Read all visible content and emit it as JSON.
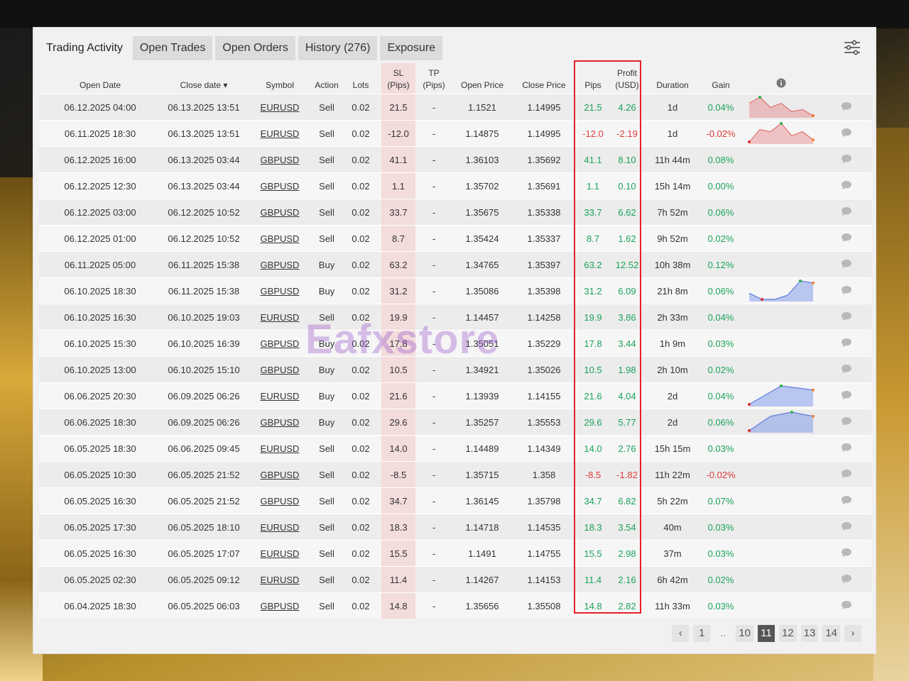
{
  "tabs": [
    {
      "label": "Trading Activity"
    },
    {
      "label": "Open Trades"
    },
    {
      "label": "Open Orders"
    },
    {
      "label": "History (276)"
    },
    {
      "label": "Exposure"
    }
  ],
  "columns": {
    "open_date": "Open Date",
    "close_date": "Close date ▾",
    "symbol": "Symbol",
    "action": "Action",
    "lots": "Lots",
    "sl_line1": "SL",
    "sl_line2": "(Pips)",
    "tp_line1": "TP",
    "tp_line2": "(Pips)",
    "open_price": "Open Price",
    "close_price": "Close Price",
    "pips": "Pips",
    "profit_line1": "Profit",
    "profit_line2": "(USD)",
    "duration": "Duration",
    "gain": "Gain"
  },
  "rows": [
    {
      "open": "06.12.2025 04:00",
      "close": "06.13.2025 13:51",
      "symbol": "EURUSD",
      "action": "Sell",
      "lots": "0.02",
      "sl": "21.5",
      "tp": "-",
      "open_price": "1.1521",
      "close_price": "1.14995",
      "pips": "21.5",
      "profit": "4.26",
      "duration": "1d",
      "gain": "0.04%",
      "neg": false,
      "spark": [
        6,
        9,
        4,
        6,
        2,
        3,
        0
      ]
    },
    {
      "open": "06.11.2025 18:30",
      "close": "06.13.2025 13:51",
      "symbol": "EURUSD",
      "action": "Sell",
      "lots": "0.02",
      "sl": "-12.0",
      "tp": "-",
      "open_price": "1.14875",
      "close_price": "1.14995",
      "pips": "-12.0",
      "profit": "-2.19",
      "duration": "1d",
      "gain": "-0.02%",
      "neg": true,
      "spark": [
        0,
        6,
        5,
        9,
        3,
        5,
        1
      ]
    },
    {
      "open": "06.12.2025 16:00",
      "close": "06.13.2025 03:44",
      "symbol": "GBPUSD",
      "action": "Sell",
      "lots": "0.02",
      "sl": "41.1",
      "tp": "-",
      "open_price": "1.36103",
      "close_price": "1.35692",
      "pips": "41.1",
      "profit": "8.10",
      "duration": "11h 44m",
      "gain": "0.08%",
      "neg": false,
      "spark": null
    },
    {
      "open": "06.12.2025 12:30",
      "close": "06.13.2025 03:44",
      "symbol": "GBPUSD",
      "action": "Sell",
      "lots": "0.02",
      "sl": "1.1",
      "tp": "-",
      "open_price": "1.35702",
      "close_price": "1.35691",
      "pips": "1.1",
      "profit": "0.10",
      "duration": "15h 14m",
      "gain": "0.00%",
      "neg": false,
      "spark": null
    },
    {
      "open": "06.12.2025 03:00",
      "close": "06.12.2025 10:52",
      "symbol": "GBPUSD",
      "action": "Sell",
      "lots": "0.02",
      "sl": "33.7",
      "tp": "-",
      "open_price": "1.35675",
      "close_price": "1.35338",
      "pips": "33.7",
      "profit": "6.62",
      "duration": "7h 52m",
      "gain": "0.06%",
      "neg": false,
      "spark": null
    },
    {
      "open": "06.12.2025 01:00",
      "close": "06.12.2025 10:52",
      "symbol": "GBPUSD",
      "action": "Sell",
      "lots": "0.02",
      "sl": "8.7",
      "tp": "-",
      "open_price": "1.35424",
      "close_price": "1.35337",
      "pips": "8.7",
      "profit": "1.62",
      "duration": "9h 52m",
      "gain": "0.02%",
      "neg": false,
      "spark": null
    },
    {
      "open": "06.11.2025 05:00",
      "close": "06.11.2025 15:38",
      "symbol": "GBPUSD",
      "action": "Buy",
      "lots": "0.02",
      "sl": "63.2",
      "tp": "-",
      "open_price": "1.34765",
      "close_price": "1.35397",
      "pips": "63.2",
      "profit": "12.52",
      "duration": "10h 38m",
      "gain": "0.12%",
      "neg": false,
      "spark": null
    },
    {
      "open": "06.10.2025 18:30",
      "close": "06.11.2025 15:38",
      "symbol": "GBPUSD",
      "action": "Buy",
      "lots": "0.02",
      "sl": "31.2",
      "tp": "-",
      "open_price": "1.35086",
      "close_price": "1.35398",
      "pips": "31.2",
      "profit": "6.09",
      "duration": "21h 8m",
      "gain": "0.06%",
      "neg": false,
      "spark": [
        3,
        0,
        0,
        2,
        9,
        8
      ]
    },
    {
      "open": "06.10.2025 16:30",
      "close": "06.10.2025 19:03",
      "symbol": "EURUSD",
      "action": "Sell",
      "lots": "0.02",
      "sl": "19.9",
      "tp": "-",
      "open_price": "1.14457",
      "close_price": "1.14258",
      "pips": "19.9",
      "profit": "3.86",
      "duration": "2h 33m",
      "gain": "0.04%",
      "neg": false,
      "spark": null
    },
    {
      "open": "06.10.2025 15:30",
      "close": "06.10.2025 16:39",
      "symbol": "GBPUSD",
      "action": "Buy",
      "lots": "0.02",
      "sl": "17.8",
      "tp": "-",
      "open_price": "1.35051",
      "close_price": "1.35229",
      "pips": "17.8",
      "profit": "3.44",
      "duration": "1h 9m",
      "gain": "0.03%",
      "neg": false,
      "spark": null
    },
    {
      "open": "06.10.2025 13:00",
      "close": "06.10.2025 15:10",
      "symbol": "GBPUSD",
      "action": "Buy",
      "lots": "0.02",
      "sl": "10.5",
      "tp": "-",
      "open_price": "1.34921",
      "close_price": "1.35026",
      "pips": "10.5",
      "profit": "1.98",
      "duration": "2h 10m",
      "gain": "0.02%",
      "neg": false,
      "spark": null
    },
    {
      "open": "06.06.2025 20:30",
      "close": "06.09.2025 06:26",
      "symbol": "EURUSD",
      "action": "Buy",
      "lots": "0.02",
      "sl": "21.6",
      "tp": "-",
      "open_price": "1.13939",
      "close_price": "1.14155",
      "pips": "21.6",
      "profit": "4.04",
      "duration": "2d",
      "gain": "0.04%",
      "neg": false,
      "spark": [
        0,
        9,
        7
      ]
    },
    {
      "open": "06.06.2025 18:30",
      "close": "06.09.2025 06:26",
      "symbol": "GBPUSD",
      "action": "Buy",
      "lots": "0.02",
      "sl": "29.6",
      "tp": "-",
      "open_price": "1.35257",
      "close_price": "1.35553",
      "pips": "29.6",
      "profit": "5.77",
      "duration": "2d",
      "gain": "0.06%",
      "neg": false,
      "spark": [
        0,
        7,
        9,
        7
      ]
    },
    {
      "open": "06.05.2025 18:30",
      "close": "06.06.2025 09:45",
      "symbol": "EURUSD",
      "action": "Sell",
      "lots": "0.02",
      "sl": "14.0",
      "tp": "-",
      "open_price": "1.14489",
      "close_price": "1.14349",
      "pips": "14.0",
      "profit": "2.76",
      "duration": "15h 15m",
      "gain": "0.03%",
      "neg": false,
      "spark": null
    },
    {
      "open": "06.05.2025 10:30",
      "close": "06.05.2025 21:52",
      "symbol": "GBPUSD",
      "action": "Sell",
      "lots": "0.02",
      "sl": "-8.5",
      "tp": "-",
      "open_price": "1.35715",
      "close_price": "1.358",
      "pips": "-8.5",
      "profit": "-1.82",
      "duration": "11h 22m",
      "gain": "-0.02%",
      "neg": true,
      "spark": null
    },
    {
      "open": "06.05.2025 16:30",
      "close": "06.05.2025 21:52",
      "symbol": "GBPUSD",
      "action": "Sell",
      "lots": "0.02",
      "sl": "34.7",
      "tp": "-",
      "open_price": "1.36145",
      "close_price": "1.35798",
      "pips": "34.7",
      "profit": "6.82",
      "duration": "5h 22m",
      "gain": "0.07%",
      "neg": false,
      "spark": null
    },
    {
      "open": "06.05.2025 17:30",
      "close": "06.05.2025 18:10",
      "symbol": "EURUSD",
      "action": "Sell",
      "lots": "0.02",
      "sl": "18.3",
      "tp": "-",
      "open_price": "1.14718",
      "close_price": "1.14535",
      "pips": "18.3",
      "profit": "3.54",
      "duration": "40m",
      "gain": "0.03%",
      "neg": false,
      "spark": null
    },
    {
      "open": "06.05.2025 16:30",
      "close": "06.05.2025 17:07",
      "symbol": "EURUSD",
      "action": "Sell",
      "lots": "0.02",
      "sl": "15.5",
      "tp": "-",
      "open_price": "1.1491",
      "close_price": "1.14755",
      "pips": "15.5",
      "profit": "2.98",
      "duration": "37m",
      "gain": "0.03%",
      "neg": false,
      "spark": null
    },
    {
      "open": "06.05.2025 02:30",
      "close": "06.05.2025 09:12",
      "symbol": "EURUSD",
      "action": "Sell",
      "lots": "0.02",
      "sl": "11.4",
      "tp": "-",
      "open_price": "1.14267",
      "close_price": "1.14153",
      "pips": "11.4",
      "profit": "2.16",
      "duration": "6h 42m",
      "gain": "0.02%",
      "neg": false,
      "spark": null
    },
    {
      "open": "06.04.2025 18:30",
      "close": "06.05.2025 06:03",
      "symbol": "GBPUSD",
      "action": "Sell",
      "lots": "0.02",
      "sl": "14.8",
      "tp": "-",
      "open_price": "1.35656",
      "close_price": "1.35508",
      "pips": "14.8",
      "profit": "2.82",
      "duration": "11h 33m",
      "gain": "0.03%",
      "neg": false,
      "spark": null
    }
  ],
  "pagination": {
    "prev": "‹",
    "pages": [
      "1",
      "..",
      "10",
      "11",
      "12",
      "13",
      "14"
    ],
    "current": "11",
    "next": "›"
  },
  "watermark": "Eafxstore",
  "colors": {
    "positive": "#1aa35a",
    "negative": "#e03a3a",
    "highlight": "#e8202a"
  }
}
